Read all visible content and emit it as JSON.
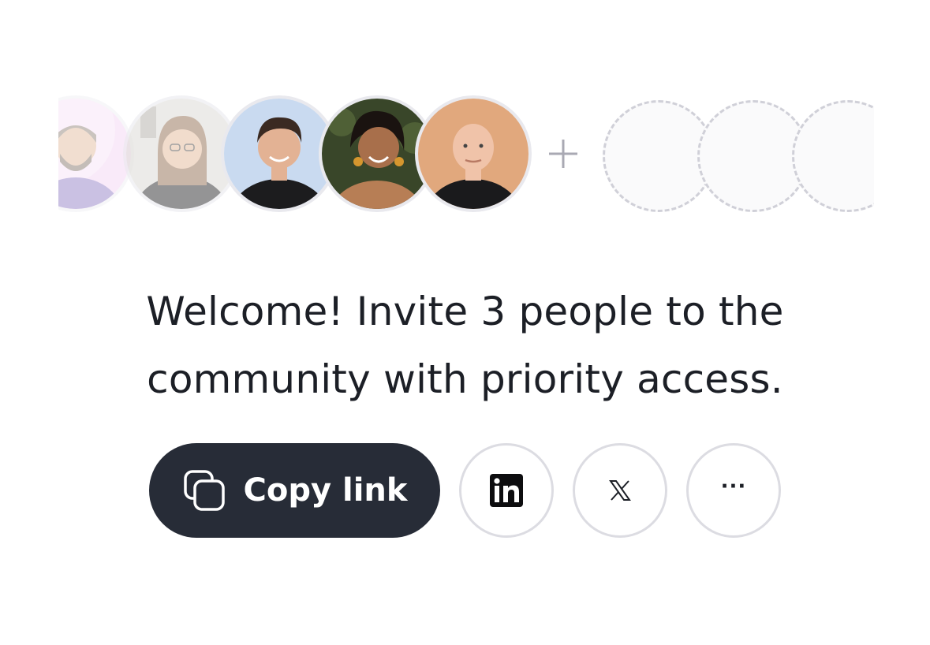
{
  "avatars": [
    {
      "name": "avatar-1-icon",
      "skin": "#d9a27c",
      "bg": "#eab9e8",
      "shirt": "#6a4fb1"
    },
    {
      "name": "avatar-2-icon",
      "skin": "#e6c0a4",
      "bg": "#d8d6d2",
      "shirt": "#3d3d40"
    },
    {
      "name": "avatar-3-icon",
      "skin": "#e3b294",
      "bg": "#c6d8ef",
      "shirt": "#1c1c1e"
    },
    {
      "name": "avatar-4-icon",
      "skin": "#a86f4b",
      "bg": "#3b4a2a",
      "shirt": "#c48e63"
    },
    {
      "name": "avatar-5-icon",
      "skin": "#f0c3a9",
      "bg": "#e0a77b",
      "shirt": "#1a1a1c"
    }
  ],
  "headline": {
    "line1": "Welcome! Invite 3 people to the",
    "line2": "community with priority access."
  },
  "actions": {
    "copy_label": "Copy link",
    "linkedin_label": "in",
    "x_label": "𝕏",
    "more_label": "···"
  },
  "colors": {
    "primary_button": "#272c37",
    "border": "#dcdce2",
    "placeholder_border": "#d0d0d8"
  }
}
